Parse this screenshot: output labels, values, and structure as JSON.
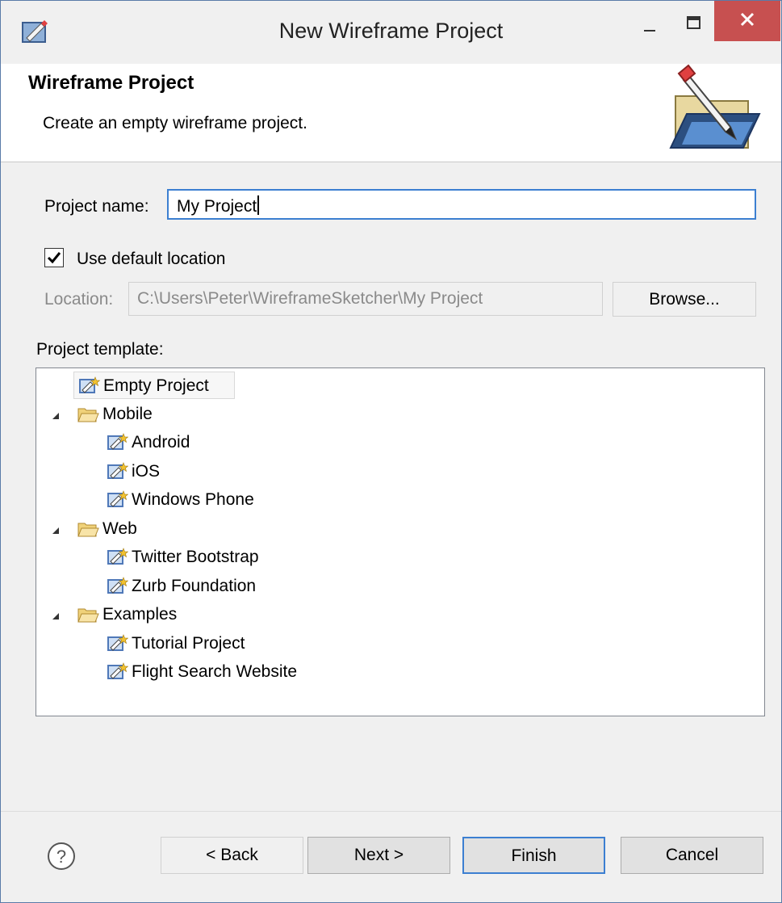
{
  "window": {
    "title": "New Wireframe Project"
  },
  "header": {
    "title": "Wireframe Project",
    "description": "Create an empty wireframe project."
  },
  "form": {
    "project_name_label": "Project name:",
    "project_name_value": "My Project",
    "use_default_location_label": "Use default location",
    "use_default_location_checked": true,
    "location_label": "Location:",
    "location_value": "C:\\Users\\Peter\\WireframeSketcher\\My Project",
    "browse_label": "Browse...",
    "project_template_label": "Project template:"
  },
  "tree": {
    "items": [
      {
        "label": "Empty Project",
        "type": "template",
        "level": 0,
        "selected": true
      },
      {
        "label": "Mobile",
        "type": "folder",
        "level": 0,
        "expanded": true
      },
      {
        "label": "Android",
        "type": "template",
        "level": 1
      },
      {
        "label": "iOS",
        "type": "template",
        "level": 1
      },
      {
        "label": "Windows Phone",
        "type": "template",
        "level": 1
      },
      {
        "label": "Web",
        "type": "folder",
        "level": 0,
        "expanded": true
      },
      {
        "label": "Twitter Bootstrap",
        "type": "template",
        "level": 1
      },
      {
        "label": "Zurb Foundation",
        "type": "template",
        "level": 1
      },
      {
        "label": "Examples",
        "type": "folder",
        "level": 0,
        "expanded": true
      },
      {
        "label": "Tutorial Project",
        "type": "template",
        "level": 1
      },
      {
        "label": "Flight Search Website",
        "type": "template",
        "level": 1
      }
    ]
  },
  "buttons": {
    "back": "< Back",
    "next": "Next >",
    "finish": "Finish",
    "cancel": "Cancel"
  },
  "icons": {
    "app": "wireframe-app-icon",
    "wizard": "wizard-pencil-folder-icon",
    "template": "template-icon",
    "folder": "folder-open-icon",
    "expander": "expanded-triangle-icon",
    "help": "help-icon",
    "minimize": "minimize-icon",
    "maximize": "maximize-icon",
    "close": "close-icon"
  },
  "colors": {
    "close_button": "#c75050",
    "focus_border": "#3c7fd1",
    "disabled_text": "#8a8a8a",
    "dialog_bg": "#f0f0f0"
  }
}
